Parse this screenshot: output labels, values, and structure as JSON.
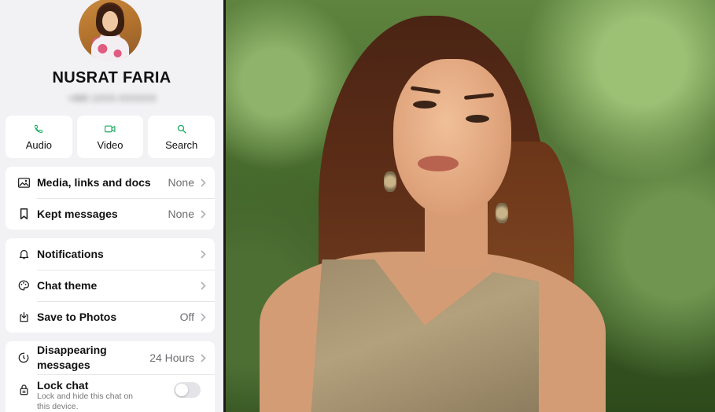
{
  "contact": {
    "name": "NUSRAT FARIA",
    "phone": "+880 1XXX-XXXXXX"
  },
  "actions": [
    {
      "label": "Audio",
      "icon": "phone-icon"
    },
    {
      "label": "Video",
      "icon": "video-icon"
    },
    {
      "label": "Search",
      "icon": "search-icon"
    }
  ],
  "media_card": {
    "media": {
      "label": "Media, links and docs",
      "value": "None"
    },
    "kept": {
      "label": "Kept messages",
      "value": "None"
    }
  },
  "settings_card": {
    "notifications": {
      "label": "Notifications"
    },
    "chat_theme": {
      "label": "Chat theme"
    },
    "save_photos": {
      "label": "Save to Photos",
      "value": "Off"
    }
  },
  "privacy_card": {
    "disappearing": {
      "label_line1": "Disappearing",
      "label_line2": "messages",
      "value": "24 Hours"
    },
    "lock": {
      "label": "Lock chat",
      "subtitle_line1": "Lock and hide this chat on",
      "subtitle_line2": "this device."
    }
  },
  "colors": {
    "accent_green": "#1daa61",
    "panel_bg": "#f2f2f5",
    "card_bg": "#ffffff"
  }
}
